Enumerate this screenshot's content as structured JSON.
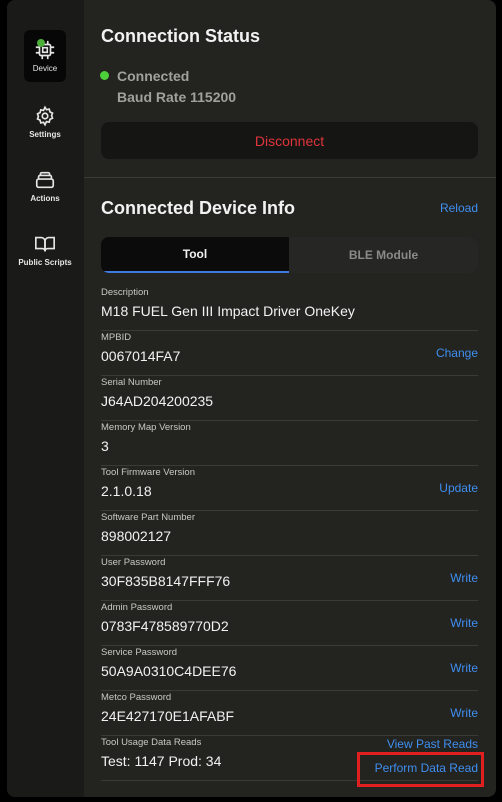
{
  "sidebar": {
    "items": [
      {
        "label": "Device",
        "icon": "chip-icon"
      },
      {
        "label": "Settings",
        "icon": "gear-icon"
      },
      {
        "label": "Actions",
        "icon": "stack-icon"
      },
      {
        "label": "Public Scripts",
        "icon": "book-icon"
      }
    ]
  },
  "connection": {
    "title": "Connection Status",
    "status": "Connected",
    "baud": "Baud Rate 115200",
    "disconnect_label": "Disconnect"
  },
  "device_info": {
    "title": "Connected Device Info",
    "reload_label": "Reload",
    "tabs": [
      {
        "label": "Tool",
        "active": true
      },
      {
        "label": "BLE Module",
        "active": false
      }
    ],
    "fields": [
      {
        "label": "Description",
        "value": "M18 FUEL Gen III Impact Driver OneKey",
        "action": ""
      },
      {
        "label": "MPBID",
        "value": "0067014FA7",
        "action": "Change"
      },
      {
        "label": "Serial Number",
        "value": "J64AD204200235",
        "action": ""
      },
      {
        "label": "Memory Map Version",
        "value": "3",
        "action": ""
      },
      {
        "label": "Tool Firmware Version",
        "value": "2.1.0.18",
        "action": "Update"
      },
      {
        "label": "Software Part Number",
        "value": "898002127",
        "action": ""
      },
      {
        "label": "User Password",
        "value": "30F835B8147FFF76",
        "action": "Write"
      },
      {
        "label": "Admin Password",
        "value": "0783F478589770D2",
        "action": "Write"
      },
      {
        "label": "Service Password",
        "value": "50A9A0310C4DEE76",
        "action": "Write"
      },
      {
        "label": "Metco Password",
        "value": "24E427170E1AFABF",
        "action": "Write"
      },
      {
        "label": "Tool Usage Data Reads",
        "value": "Test: 1147 Prod: 34",
        "action": "View Past Reads",
        "action2": "Perform Data Read"
      }
    ]
  },
  "colors": {
    "accent": "#3f8ff0",
    "danger": "#e0353a",
    "connected": "#4dd13a",
    "highlight": "#e02020"
  }
}
